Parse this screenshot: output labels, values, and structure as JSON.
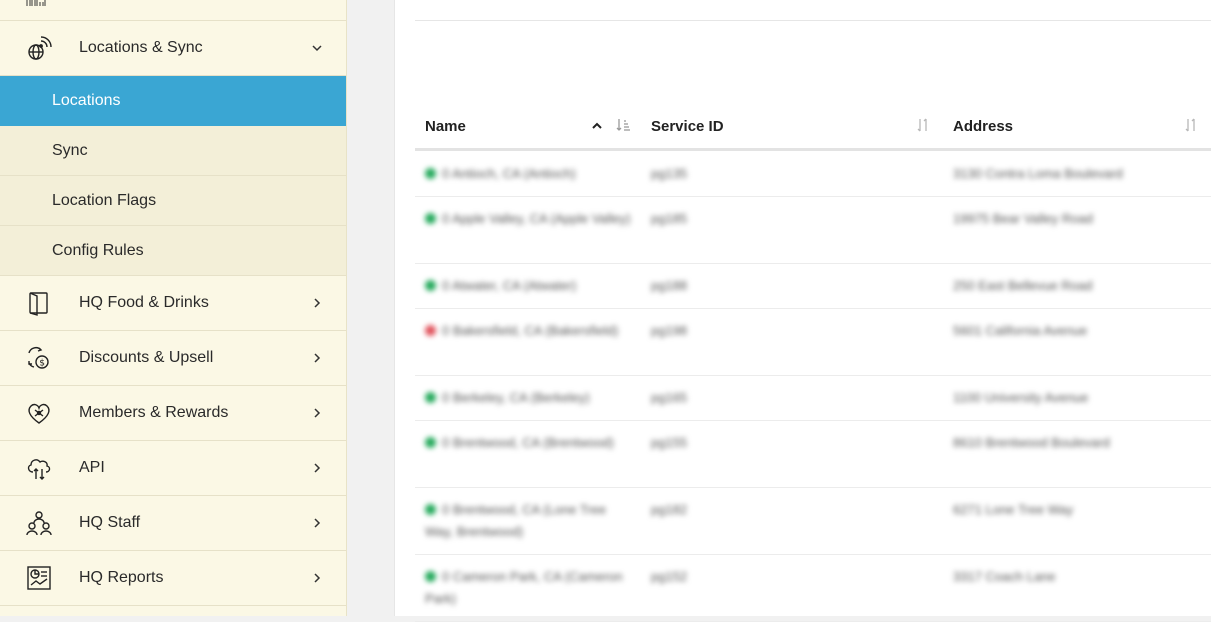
{
  "sidebar": {
    "group_open": {
      "label": "Locations & Sync",
      "icon": "globe-signal-icon"
    },
    "subitems": [
      {
        "label": "Locations",
        "active": true
      },
      {
        "label": "Sync",
        "active": false
      },
      {
        "label": "Location Flags",
        "active": false
      },
      {
        "label": "Config Rules",
        "active": false
      }
    ],
    "items": [
      {
        "label": "HQ Food & Drinks",
        "icon": "menu-book-icon"
      },
      {
        "label": "Discounts & Upsell",
        "icon": "discount-exchange-icon"
      },
      {
        "label": "Members & Rewards",
        "icon": "heart-gift-icon"
      },
      {
        "label": "API",
        "icon": "cloud-transfer-icon"
      },
      {
        "label": "HQ Staff",
        "icon": "staff-group-icon"
      },
      {
        "label": "HQ Reports",
        "icon": "report-chart-icon"
      }
    ]
  },
  "table": {
    "columns": [
      {
        "label": "Name",
        "sort": "ascending"
      },
      {
        "label": "Service ID",
        "sort": "none"
      },
      {
        "label": "Address",
        "sort": "none"
      }
    ],
    "rows": [
      {
        "status": "green",
        "name": "0 Antioch, CA (Antioch)",
        "service_id": "pg135",
        "address": "3130 Contra Loma Boulevard"
      },
      {
        "status": "green",
        "name": "0 Apple Valley, CA (Apple Valley)",
        "service_id": "pg185",
        "address": "19975 Bear Valley Road"
      },
      {
        "status": "green",
        "name": "0 Atwater, CA (Atwater)",
        "service_id": "pg188",
        "address": "250 East Bellevue Road"
      },
      {
        "status": "red",
        "name": "0 Bakersfield, CA (Bakersfield)",
        "service_id": "pg198",
        "address": "5601 California Avenue"
      },
      {
        "status": "green",
        "name": "0 Berkeley, CA (Berkeley)",
        "service_id": "pg165",
        "address": "1100 University Avenue"
      },
      {
        "status": "green",
        "name": "0 Brentwood, CA (Brentwood)",
        "service_id": "pg155",
        "address": "8610 Brentwood Boulevard"
      },
      {
        "status": "green",
        "name": "0 Brentwood, CA (Lone Tree Way, Brentwood)",
        "service_id": "pg182",
        "address": "6271 Lone Tree Way"
      },
      {
        "status": "green",
        "name": "0 Cameron Park, CA (Cameron Park)",
        "service_id": "pg152",
        "address": "3317 Coach Lane"
      }
    ]
  },
  "colors": {
    "sidebar_bg": "#fbf8e5",
    "active_bg": "#3aa6d3",
    "status_green": "#22a85a",
    "status_red": "#e0505a"
  }
}
